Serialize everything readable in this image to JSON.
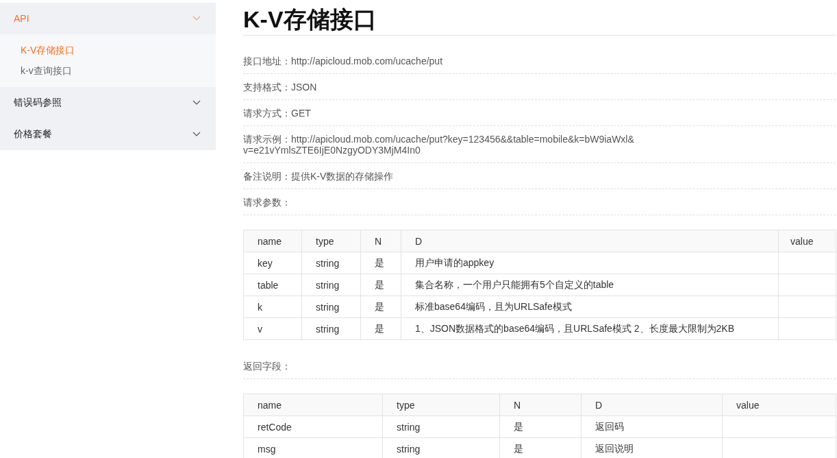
{
  "sidebar": {
    "sections": [
      {
        "label": "API",
        "selected": true,
        "children": [
          {
            "label": "K-V存储接口",
            "selected": true
          },
          {
            "label": "k-v查询接口",
            "selected": false
          }
        ]
      },
      {
        "label": "错误码参照",
        "selected": false
      },
      {
        "label": "价格套餐",
        "selected": false
      }
    ]
  },
  "page": {
    "title": "K-V存储接口",
    "info": [
      "接口地址：http://apicloud.mob.com/ucache/put",
      "支持格式：JSON",
      "请求方式：GET",
      "请求示例：http://apicloud.mob.com/ucache/put?key=123456&&table=mobile&k=bW9iaWxl&\nv=e21vYmlsZTE6IjE0NzgyODY3MjM4In0",
      "备注说明：提供K-V数据的存储操作",
      "请求参数："
    ],
    "request_table": {
      "columns": [
        "name",
        "type",
        "N",
        "D",
        "value"
      ],
      "rows": [
        [
          "key",
          "string",
          "是",
          "用户申请的appkey"
        ],
        [
          "table",
          "string",
          "是",
          "集合名称，一个用户只能拥有5个自定义的table"
        ],
        [
          "k",
          "string",
          "是",
          "标准base64编码，且为URLSafe模式"
        ],
        [
          "v",
          "string",
          "是",
          "1、JSON数据格式的base64编码，且URLSafe模式 2、长度最大限制为2KB"
        ]
      ]
    },
    "return_label": "返回字段：",
    "return_table": {
      "columns": [
        "name",
        "type",
        "N",
        "D",
        "value"
      ],
      "rows": [
        [
          "retCode",
          "string",
          "是",
          "返回码"
        ],
        [
          "msg",
          "string",
          "是",
          "返回说明"
        ]
      ]
    }
  }
}
